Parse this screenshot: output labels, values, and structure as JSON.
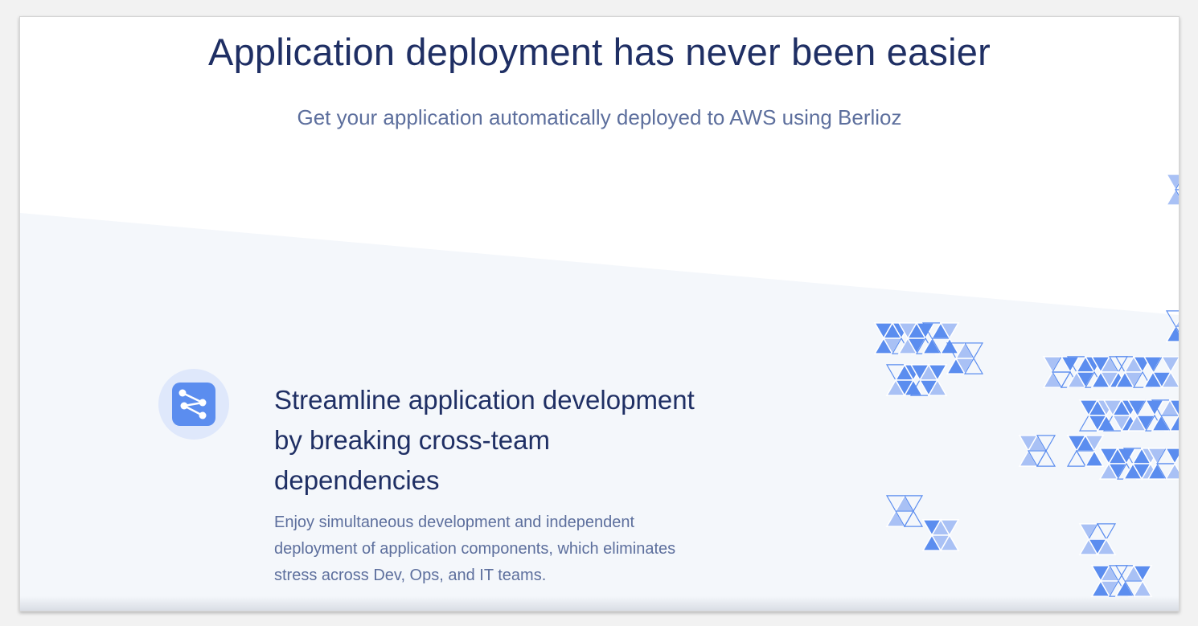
{
  "hero": {
    "title": "Application deployment has never been easier",
    "subtitle": "Get your application automatically deployed to AWS using Berlioz"
  },
  "feature": {
    "icon": "share-nodes-icon",
    "title_lines": [
      "Streamline application development",
      "by breaking cross-team",
      "dependencies"
    ],
    "description_lines": [
      "Enjoy simultaneous development and independent",
      "deployment of application components, which eliminates",
      "stress across Dev, Ops, and IT teams."
    ]
  },
  "colors": {
    "heading": "#1f2f64",
    "body_text": "#5d6f9d",
    "accent": "#5b8def",
    "accent_light": "#a9c1f5",
    "section_bg": "#f4f7fb",
    "icon_circle": "#dfe8fb"
  }
}
